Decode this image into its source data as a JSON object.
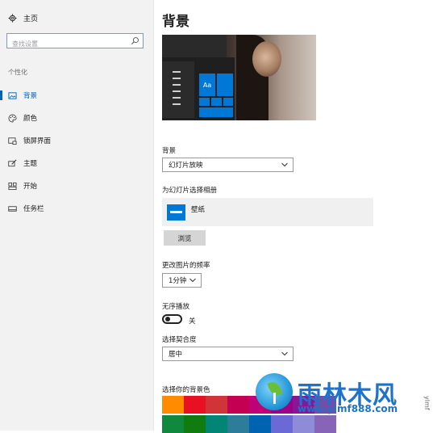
{
  "sidebar": {
    "home_label": "主页",
    "search_placeholder": "查找设置",
    "section_label": "个性化",
    "items": [
      {
        "label": "背景",
        "icon": "image-icon",
        "active": true
      },
      {
        "label": "颜色",
        "icon": "palette-icon",
        "active": false
      },
      {
        "label": "锁屏界面",
        "icon": "lock-screen-icon",
        "active": false
      },
      {
        "label": "主题",
        "icon": "theme-brush-icon",
        "active": false
      },
      {
        "label": "开始",
        "icon": "start-grid-icon",
        "active": false
      },
      {
        "label": "任务栏",
        "icon": "taskbar-icon",
        "active": false
      }
    ]
  },
  "main": {
    "title": "背景",
    "preview_tile_label": "Aa",
    "background_label": "背景",
    "background_value": "幻灯片放映",
    "album_label": "为幻灯片选择相册",
    "album_name": "壁纸",
    "browse_label": "浏览",
    "frequency_label": "更改图片的频率",
    "frequency_value": "1分钟",
    "shuffle_label": "无序播放",
    "shuffle_state": "关",
    "fit_label": "选择契合度",
    "fit_value": "居中",
    "color_label": "选择你的背景色",
    "colors_row1": [
      "#ff8c00",
      "#e81123",
      "#d13438",
      "#c30052",
      "#bf0077",
      "#9a0089",
      "#881798",
      "#744da9"
    ],
    "colors_row2": [
      "#10893e",
      "#107c10",
      "#018574",
      "#2d7d9a",
      "#0063b1",
      "#6b69d6",
      "#8e8cd8",
      "#8764b8"
    ]
  },
  "watermark": {
    "title": "雨林木风",
    "url": "www.ylmf888.com",
    "side_text": "ylmf"
  },
  "colors": {
    "accent": "#0063b1",
    "tile": "#0078d7",
    "brand": "#1e73c8"
  }
}
